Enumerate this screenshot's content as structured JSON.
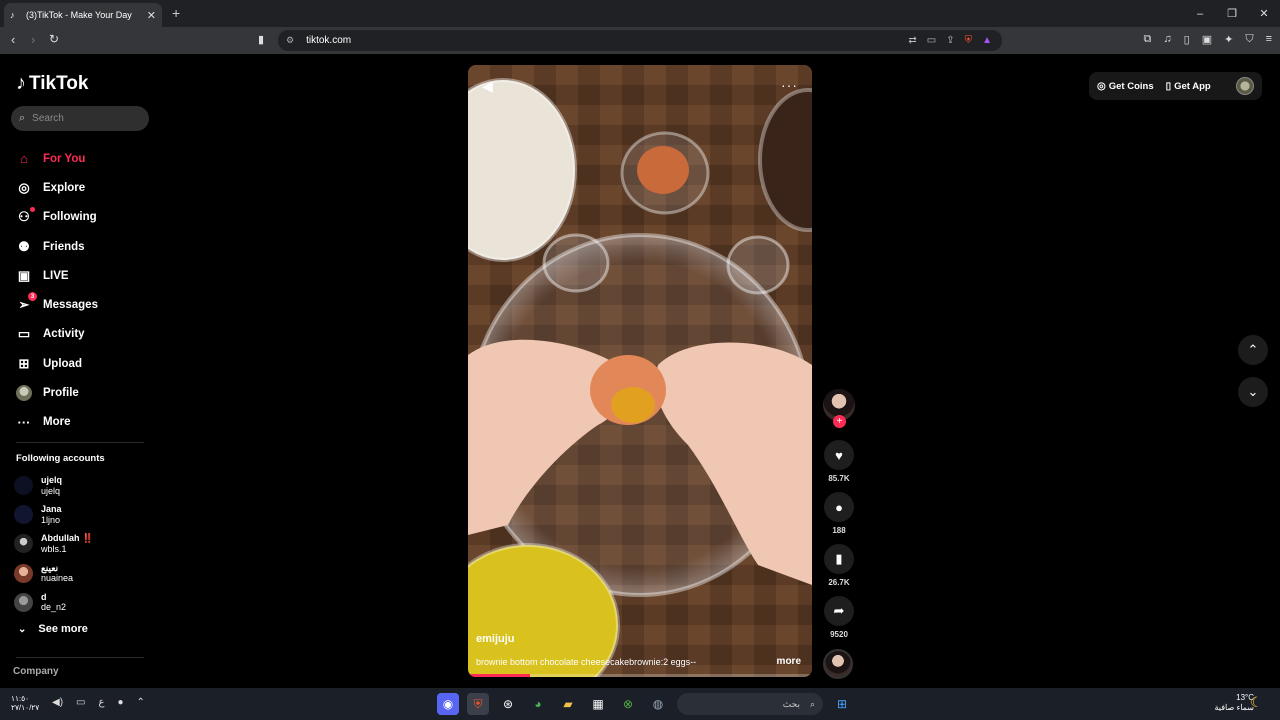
{
  "browser": {
    "tab_title": "(3)TikTok - Make Your Day",
    "url": "tiktok.com",
    "new_tab": "+",
    "minimize": "–",
    "maximize": "❐",
    "close": "✕"
  },
  "sidebar": {
    "logo": "TikTok",
    "search_placeholder": "Search",
    "nav": [
      {
        "label": "For You",
        "icon": "home-icon"
      },
      {
        "label": "Explore",
        "icon": "compass-icon"
      },
      {
        "label": "Following",
        "icon": "following-icon"
      },
      {
        "label": "Friends",
        "icon": "friends-icon"
      },
      {
        "label": "LIVE",
        "icon": "live-icon"
      },
      {
        "label": "Messages",
        "icon": "messages-icon",
        "badge": "3"
      },
      {
        "label": "Activity",
        "icon": "activity-icon"
      },
      {
        "label": "Upload",
        "icon": "upload-icon"
      },
      {
        "label": "Profile",
        "icon": "profile-avatar"
      },
      {
        "label": "More",
        "icon": "more-icon"
      }
    ],
    "following_title": "Following accounts",
    "accounts": [
      {
        "display": "ujelq",
        "handle": "ujelq"
      },
      {
        "display": "Jana",
        "handle": "1ljno"
      },
      {
        "display": "Abdullah ‼️",
        "handle": "wbls.1"
      },
      {
        "display": "نعينع",
        "handle": "nuainea"
      },
      {
        "display": "d",
        "handle": "de_n2"
      }
    ],
    "see_more": "See more",
    "company": "Company"
  },
  "video": {
    "author": "emijuju",
    "caption": "brownie bottom chocolate cheesecakebrownie:2 eggs--",
    "more": "more",
    "progress": 0.18
  },
  "actions": {
    "likes": "85.7K",
    "comments": "188",
    "saves": "26.7K",
    "shares": "9520"
  },
  "top_right": {
    "get_coins": "Get Coins",
    "get_app": "Get App"
  },
  "taskbar": {
    "time": "١١:٥٠",
    "date": "٢٧/١٠/٢٧",
    "lang": "ع",
    "search_label": "بحث",
    "weather_temp": "13°C",
    "weather_desc": "سماء صافية"
  },
  "colors": {
    "accent": "#fe2c55",
    "background": "#000000"
  }
}
